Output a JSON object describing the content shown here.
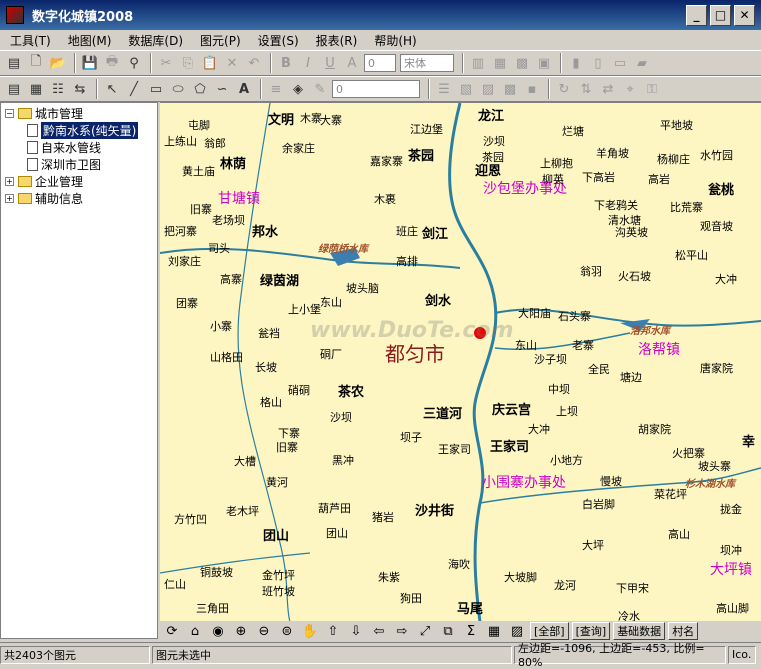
{
  "window": {
    "title": "数字化城镇2008"
  },
  "menu": [
    "工具(T)",
    "地图(M)",
    "数据库(D)",
    "图元(P)",
    "设置(S)",
    "报表(R)",
    "帮助(H)"
  ],
  "toolbar": {
    "layer_combo": "0",
    "font_combo": "宋体",
    "line_combo": "0"
  },
  "tree": {
    "root1": "城市管理",
    "children": [
      "黔南水系(纯矢量)",
      "自来水管线",
      "深圳市卫图"
    ],
    "root2": "企业管理",
    "root3": "辅助信息"
  },
  "map": {
    "city": "都匀市",
    "watermark": "www.DuoTe.com",
    "towns": [
      "甘塘镇",
      "沙包堡办事处",
      "洛帮镇",
      "小围寨办事处",
      "大坪镇"
    ],
    "reservoirs": [
      "绿荫桥水库",
      "洛邦水库",
      "杉木湖水库"
    ],
    "places": [
      {
        "t": "文明",
        "b": true
      },
      {
        "t": "林荫",
        "b": true
      },
      {
        "t": "邦水",
        "b": true
      },
      {
        "t": "绿茵湖",
        "b": true
      },
      {
        "t": "茶园",
        "b": true
      },
      {
        "t": "剑江",
        "b": true
      },
      {
        "t": "剑水",
        "b": true
      },
      {
        "t": "龙江",
        "b": true
      },
      {
        "t": "迎恩",
        "b": true
      },
      {
        "t": "瓮桃",
        "b": true
      },
      {
        "t": "茶农",
        "b": true
      },
      {
        "t": "三道河",
        "b": true
      },
      {
        "t": "庆云宫",
        "b": true
      },
      {
        "t": "王家司",
        "b": true
      },
      {
        "t": "沙井街",
        "b": true
      },
      {
        "t": "团山",
        "b": true
      },
      {
        "t": "马尾",
        "b": true
      },
      {
        "t": "幸",
        "b": true
      },
      {
        "t": "屯脚"
      },
      {
        "t": "大寨"
      },
      {
        "t": "上练山"
      },
      {
        "t": "翁郎"
      },
      {
        "t": "黄土庙"
      },
      {
        "t": "余家庄"
      },
      {
        "t": "江边堡"
      },
      {
        "t": "沙坝"
      },
      {
        "t": "茶园"
      },
      {
        "t": "烂塘"
      },
      {
        "t": "平地坡"
      },
      {
        "t": "上柳抱"
      },
      {
        "t": "羊角坡"
      },
      {
        "t": "杨柳庄"
      },
      {
        "t": "水竹园"
      },
      {
        "t": "嘉家寨"
      },
      {
        "t": "柳英"
      },
      {
        "t": "下高岩"
      },
      {
        "t": "高岩"
      },
      {
        "t": "木裹"
      },
      {
        "t": "旧寨"
      },
      {
        "t": "老场坝"
      },
      {
        "t": "下老鸦关"
      },
      {
        "t": "比荒寨"
      },
      {
        "t": "清水塘"
      },
      {
        "t": "观音坡"
      },
      {
        "t": "把河寨"
      },
      {
        "t": "沟英坡"
      },
      {
        "t": "司头"
      },
      {
        "t": "班庄"
      },
      {
        "t": "刘家庄"
      },
      {
        "t": "高排"
      },
      {
        "t": "松平山"
      },
      {
        "t": "高寨"
      },
      {
        "t": "坡头脑"
      },
      {
        "t": "翁羽"
      },
      {
        "t": "火石坡"
      },
      {
        "t": "大冲"
      },
      {
        "t": "团寨"
      },
      {
        "t": "东山"
      },
      {
        "t": "上小堡"
      },
      {
        "t": "大阳庙"
      },
      {
        "t": "石头寨"
      },
      {
        "t": "小寨"
      },
      {
        "t": "瓮裆"
      },
      {
        "t": "山格田"
      },
      {
        "t": "东山"
      },
      {
        "t": "老寨"
      },
      {
        "t": "沙子坝"
      },
      {
        "t": "长坡"
      },
      {
        "t": "硐厂"
      },
      {
        "t": "全民"
      },
      {
        "t": "塘边"
      },
      {
        "t": "唐家院"
      },
      {
        "t": "硝硐"
      },
      {
        "t": "中坝"
      },
      {
        "t": "格山"
      },
      {
        "t": "沙坝"
      },
      {
        "t": "上坝"
      },
      {
        "t": "胡家院"
      },
      {
        "t": "下寨"
      },
      {
        "t": "旧寨"
      },
      {
        "t": "坝子"
      },
      {
        "t": "大冲"
      },
      {
        "t": "王家司"
      },
      {
        "t": "大槽"
      },
      {
        "t": "黑冲"
      },
      {
        "t": "小地方"
      },
      {
        "t": "火把寨"
      },
      {
        "t": "黄河"
      },
      {
        "t": "慢坡"
      },
      {
        "t": "坡头寨"
      },
      {
        "t": "葫芦田"
      },
      {
        "t": "白岩脚"
      },
      {
        "t": "菜花坪"
      },
      {
        "t": "方竹凹"
      },
      {
        "t": "老木坪"
      },
      {
        "t": "团山"
      },
      {
        "t": "猪岩"
      },
      {
        "t": "拢金"
      },
      {
        "t": "大坪"
      },
      {
        "t": "高山"
      },
      {
        "t": "海吹"
      },
      {
        "t": "铜鼓坡"
      },
      {
        "t": "金竹坪"
      },
      {
        "t": "朱紫"
      },
      {
        "t": "大坡脚"
      },
      {
        "t": "班竹坡"
      },
      {
        "t": "狗田"
      },
      {
        "t": "仁山"
      },
      {
        "t": "三角田"
      },
      {
        "t": "龙河"
      },
      {
        "t": "下甲宋"
      },
      {
        "t": "高山脚"
      },
      {
        "t": "冷水"
      },
      {
        "t": "坝冲"
      },
      {
        "t": "木寨"
      }
    ]
  },
  "map_toolbar": {
    "all": "[全部]",
    "query": "[查询]",
    "basic": "基础数据",
    "village": "村名"
  },
  "status": {
    "count": "共2403个图元",
    "selection": "图元未选中",
    "coords": "左边距=-1096, 上边距=-453, 比例= 80%",
    "extra": "Ico."
  }
}
